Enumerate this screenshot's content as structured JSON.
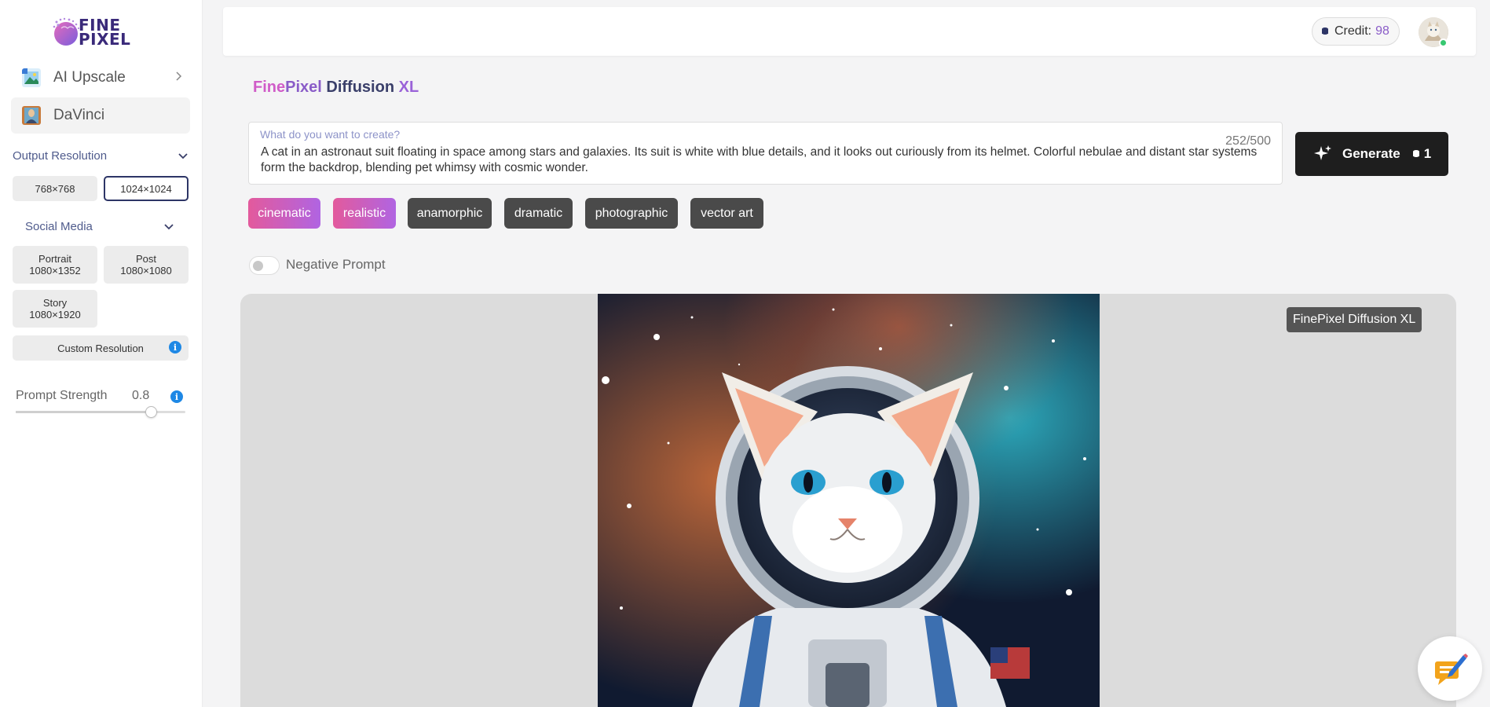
{
  "brand": {
    "logo_line1": "FINE",
    "logo_line2": "PIXEL"
  },
  "sidebar": {
    "nav": [
      {
        "label": "AI Upscale",
        "icon": "image-upscale-icon"
      },
      {
        "label": "DaVinci",
        "icon": "davinci-portrait-icon"
      }
    ],
    "output_resolution": {
      "title": "Output Resolution",
      "options": [
        "768×768",
        "1024×1024"
      ],
      "selected": "1024×1024"
    },
    "social_media": {
      "title": "Social Media",
      "portrait": {
        "name": "Portrait",
        "size": "1080×1352"
      },
      "post": {
        "name": "Post",
        "size": "1080×1080"
      },
      "story": {
        "name": "Story",
        "size": "1080×1920"
      }
    },
    "custom_resolution": "Custom Resolution",
    "prompt_strength": {
      "label": "Prompt Strength",
      "value": "0.8",
      "level": 0.8,
      "min": 0,
      "max": 1
    }
  },
  "header": {
    "credit_label": "Credit:",
    "credit_value": "98"
  },
  "main": {
    "title_parts": [
      "Fine",
      "Pixel",
      " Diffusion",
      " XL"
    ],
    "prompt": {
      "placeholder": "What do you want to create?",
      "value": "A cat in an astronaut suit floating in space among stars and galaxies. Its suit is white with blue details, and it looks out curiously from its helmet. Colorful nebulae and distant star systems form the backdrop, blending pet whimsy with cosmic wonder.",
      "counter": "252/500"
    },
    "generate": {
      "label": "Generate",
      "cost": "1"
    },
    "styles": [
      {
        "label": "cinematic",
        "active": true
      },
      {
        "label": "realistic",
        "active": true
      },
      {
        "label": "anamorphic",
        "active": false
      },
      {
        "label": "dramatic",
        "active": false
      },
      {
        "label": "photographic",
        "active": false
      },
      {
        "label": "vector art",
        "active": false
      }
    ],
    "negative_prompt": {
      "label": "Negative Prompt",
      "enabled": false
    },
    "model_badge": "FinePixel Diffusion XL"
  },
  "colors": {
    "accent_pink": "#e35a9c",
    "accent_purple": "#b064e2",
    "dark_button": "#1e1e1e",
    "info_blue": "#1e88e5"
  }
}
